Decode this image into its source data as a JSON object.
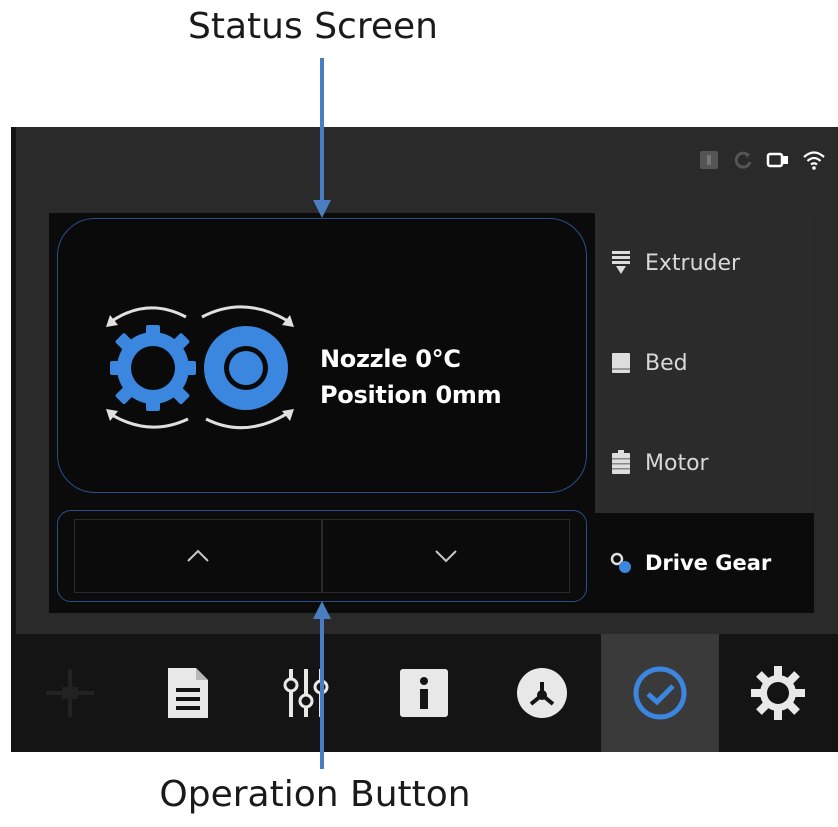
{
  "annotations": {
    "status_screen": "Status  Screen",
    "operation_button": "Operation  Button"
  },
  "status": {
    "nozzle": "Nozzle 0°C",
    "position": "Position 0mm"
  },
  "side_menu": [
    {
      "label": "Extruder",
      "icon": "extruder-icon",
      "active": false
    },
    {
      "label": "Bed",
      "icon": "bed-icon",
      "active": false
    },
    {
      "label": "Motor",
      "icon": "motor-icon",
      "active": false
    },
    {
      "label": "Drive Gear",
      "icon": "drive-gear-icon",
      "active": true
    }
  ],
  "operation_buttons": [
    {
      "icon": "chevron-up-icon"
    },
    {
      "icon": "chevron-down-icon"
    }
  ],
  "bottom_bar": [
    {
      "icon": "crosshair-move-icon",
      "active": false
    },
    {
      "icon": "file-icon",
      "active": false
    },
    {
      "icon": "sliders-icon",
      "active": false
    },
    {
      "icon": "info-icon",
      "active": false
    },
    {
      "icon": "filament-icon",
      "active": false
    },
    {
      "icon": "check-circle-icon",
      "active": true
    },
    {
      "icon": "settings-gear-icon",
      "active": false
    }
  ],
  "colors": {
    "accent": "#3b86de",
    "background": "#2a2a2a",
    "panel": "#0b0b0b",
    "border": "#2a4f88",
    "annotation_arrow": "#4a7ec0"
  }
}
